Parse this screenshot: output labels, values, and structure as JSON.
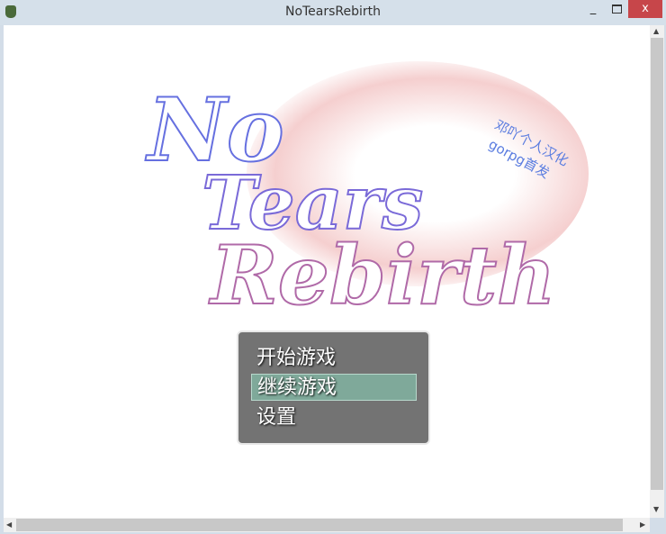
{
  "window": {
    "title": "NoTearsRebirth",
    "minimize": "_",
    "close": "x"
  },
  "logo": {
    "line1": "No",
    "line2": "Tears",
    "line3": "Rebirth"
  },
  "credit": {
    "line1": "邓吖个人汉化",
    "line2": "gorpg首发"
  },
  "menu": {
    "items": [
      {
        "label": "开始游戏"
      },
      {
        "label": "继续游戏",
        "selected": true
      },
      {
        "label": "设置"
      }
    ]
  }
}
